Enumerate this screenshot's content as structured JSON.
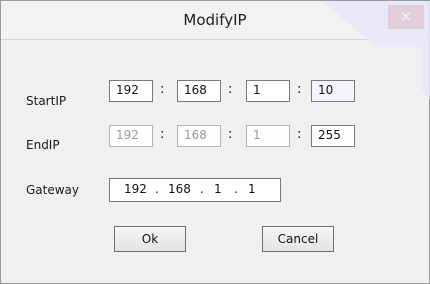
{
  "window": {
    "title": "ModifyIP",
    "close_glyph": "×"
  },
  "start_ip": {
    "label": "StartIP",
    "octets": [
      "192",
      "168",
      "1",
      "10"
    ]
  },
  "end_ip": {
    "label": "EndIP",
    "octets": [
      "192",
      "168",
      "1",
      "255"
    ]
  },
  "separator": ":",
  "gateway": {
    "label": "Gateway",
    "octets": [
      "192",
      "168",
      "1",
      "1"
    ],
    "dot": "."
  },
  "buttons": {
    "ok": "Ok",
    "cancel": "Cancel"
  },
  "colors": {
    "close": "#c9443a",
    "watermark": "#e2e2f6"
  }
}
